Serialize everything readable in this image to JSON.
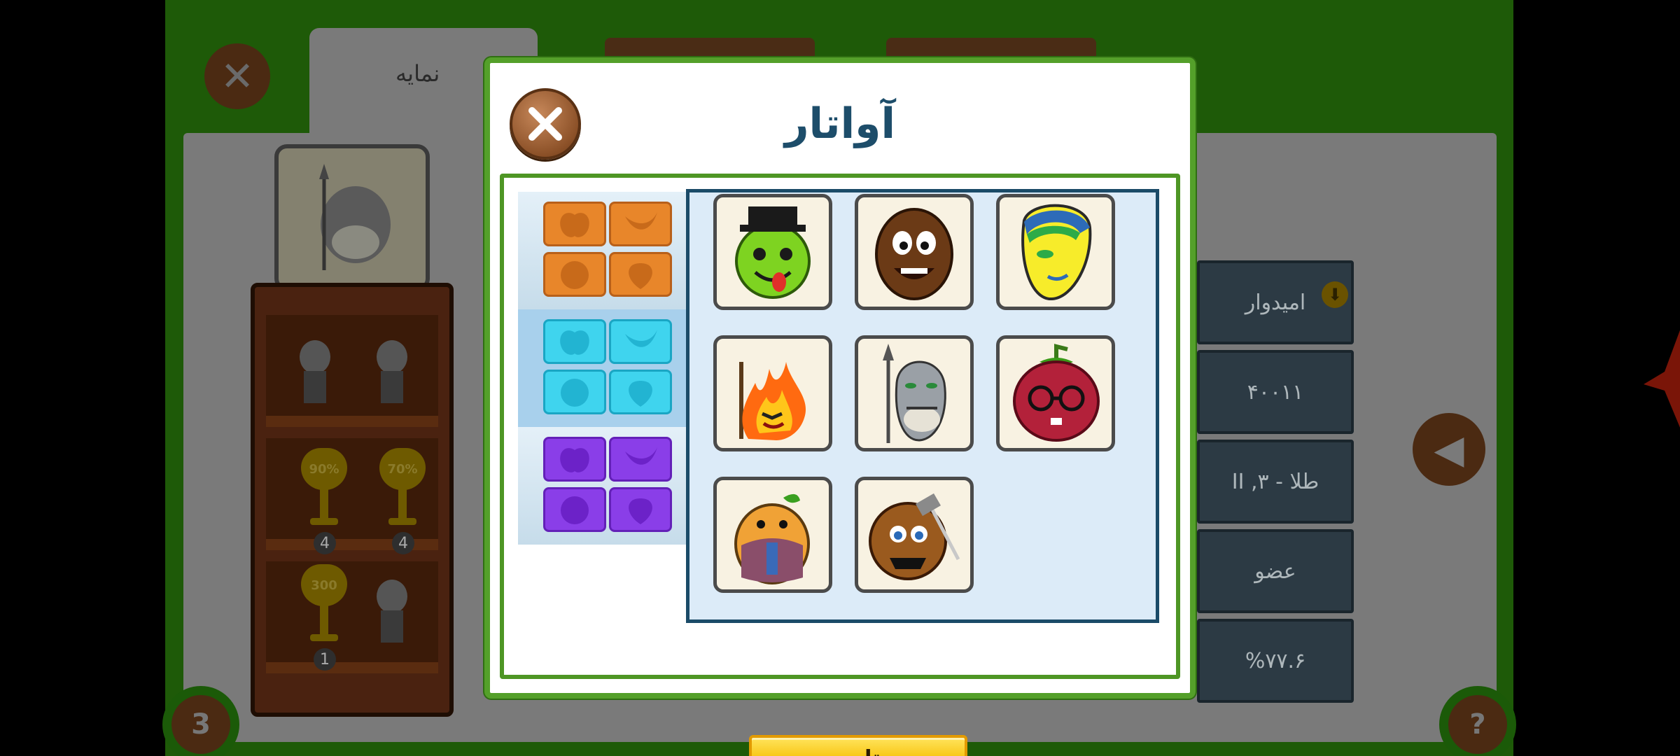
{
  "background": {
    "tab_profile_label": "نمایه",
    "info_rows": [
      "امیدوار",
      "۴۰۰۱۱",
      "طلا - II ,۳",
      "عضو",
      "%۷۷.۶"
    ],
    "trophies": [
      {
        "label": "90%",
        "count": "4"
      },
      {
        "label": "70%",
        "count": "4"
      },
      {
        "label": "300",
        "count": "1"
      }
    ],
    "chat_badge": "3",
    "help_label": "?",
    "accent_color": "#1e5a08"
  },
  "dialog": {
    "title": "آواتار",
    "confirm_label": "تایید",
    "close_icon": "close-icon",
    "color_tabs": [
      {
        "name": "orange",
        "color": "#e8862a",
        "selected": false
      },
      {
        "name": "cyan",
        "color": "#3fd4ee",
        "selected": true
      },
      {
        "name": "purple",
        "color": "#8a3ee8",
        "selected": false
      }
    ],
    "avatars": [
      {
        "name": "green-apple-top-hat"
      },
      {
        "name": "coconut"
      },
      {
        "name": "mask"
      },
      {
        "name": "fire-demon"
      },
      {
        "name": "shark-spear"
      },
      {
        "name": "berry-glasses"
      },
      {
        "name": "potato-gentleman"
      },
      {
        "name": "coconut-axe"
      }
    ],
    "selected_avatar": "shark-spear"
  }
}
